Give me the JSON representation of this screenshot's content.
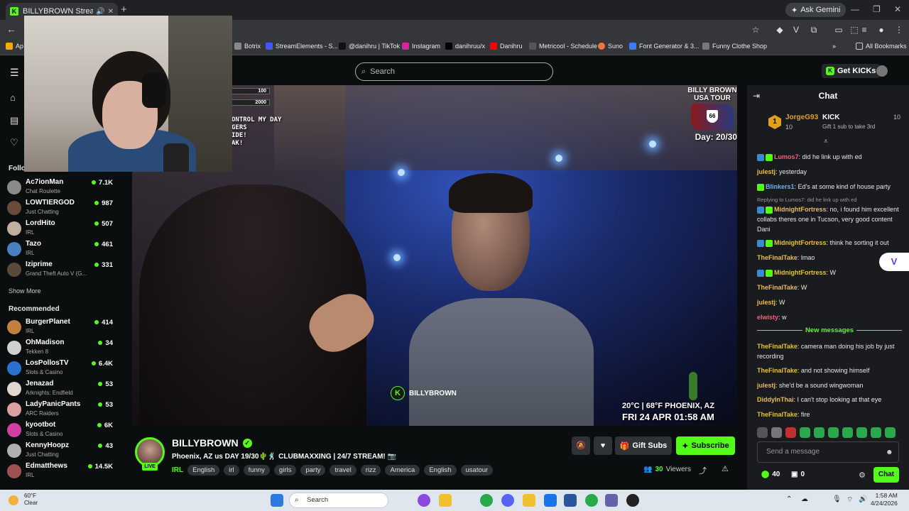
{
  "browser": {
    "tab_title": "BILLYBROWN Stream - Wa",
    "gemini_label": "Ask Gemini",
    "bookmarks": [
      "Ap",
      "Botrix",
      "StreamElements - S...",
      "@danihru | TikTok",
      "Instagram",
      "danihruu/x",
      "Danihru",
      "Metricool - Schedule",
      "Suno",
      "Font Generator & 3...",
      "Funny Clothe Shop"
    ],
    "all_bookmarks": "All Bookmarks"
  },
  "header": {
    "search_placeholder": "Search",
    "get_kicks": "Get KICKs"
  },
  "sidebar": {
    "following_title": "Follo",
    "following": [
      {
        "name": "Ac7ionMan",
        "category": "Chat Roulette",
        "viewers": "7.1K"
      },
      {
        "name": "LOWTIERGOD",
        "category": "Just Chatting",
        "viewers": "987"
      },
      {
        "name": "LordHito",
        "category": "IRL",
        "viewers": "507"
      },
      {
        "name": "Tazo",
        "category": "IRL",
        "viewers": "461"
      },
      {
        "name": "Iziprime",
        "category": "Grand Theft Auto V (G...",
        "viewers": "331"
      }
    ],
    "show_more": "Show More",
    "recommended_title": "Recommended",
    "recommended": [
      {
        "name": "BurgerPlanet",
        "category": "IRL",
        "viewers": "414"
      },
      {
        "name": "OhMadison",
        "category": "Tekken 8",
        "viewers": "34"
      },
      {
        "name": "LosPollosTV",
        "category": "Slots & Casino",
        "viewers": "6.4K"
      },
      {
        "name": "Jenazad",
        "category": "Arknights: Endfield",
        "viewers": "53"
      },
      {
        "name": "LadyPanicPants",
        "category": "ARC Raiders",
        "viewers": "53"
      },
      {
        "name": "kyootbot",
        "category": "Slots & Casino",
        "viewers": "6K"
      },
      {
        "name": "KennyHoopz",
        "category": "Just Chatting",
        "viewers": "43"
      },
      {
        "name": "Edmatthews",
        "category": "IRL",
        "viewers": "14.5K"
      }
    ]
  },
  "video": {
    "goal1": "100",
    "goal2": "2000",
    "overlay_lines": [
      "ONTROL MY DAY",
      "GERS",
      "IDE!",
      "AK!"
    ],
    "tour_title": "BILLY BROWN USA TOUR",
    "tour_route": "66",
    "tour_day": "Day: 20/30",
    "watermark": "BILLYBROWN",
    "weather": "20°C | 68°F PHOENIX, AZ",
    "date": "FRI 24 APR 01:58 AM"
  },
  "stream": {
    "channel": "BILLYBROWN",
    "live": "LIVE",
    "title": "Phoenix, AZ us DAY 19/30🌵🕺 CLUBMAXXING | 24/7 STREAM! 📷",
    "category": "IRL",
    "tags": [
      "English",
      "irl",
      "funny",
      "girls",
      "party",
      "travel",
      "rizz",
      "America",
      "English",
      "usatour"
    ],
    "gift_subs": "Gift Subs",
    "subscribe": "Subscribe",
    "viewers": "30",
    "viewers_label": "Viewers"
  },
  "chat": {
    "title": "Chat",
    "pinned": {
      "rank": "1",
      "user": "JorgeG93",
      "count": "10",
      "kick": "KICK",
      "kick_count": "10",
      "gift_text": "Gift 1 sub to take 3rd"
    },
    "messages": [
      {
        "user": "Lumos7",
        "text": "did he link up with ed",
        "color": "#ff5a7a"
      },
      {
        "user": "julestj",
        "text": "yesterday",
        "color": "#e8c040"
      },
      {
        "user": "Blinkers1",
        "text": "Ed's at some kind of house party",
        "color": "#6ab0ff"
      },
      {
        "user": "MidnightFortress",
        "text": "no, i found him excellent collabs theres one in Tucson, very good content Dani",
        "color": "#e8c040"
      },
      {
        "user": "MidnightFortress",
        "text": "think he sorting it out",
        "color": "#e8c040"
      },
      {
        "user": "TheFinalTake",
        "text": "lmao",
        "color": "#e8c040"
      },
      {
        "user": "MidnightFortress",
        "text": "W",
        "color": "#e8c040"
      },
      {
        "user": "TheFinalTake",
        "text": "W",
        "color": "#e8c040"
      },
      {
        "user": "julestj",
        "text": "W",
        "color": "#e8c040"
      },
      {
        "user": "elwisty",
        "text": "w",
        "color": "#ff5a7a"
      },
      {
        "user": "TheFinalTake",
        "text": "camera man doing his job by just recording",
        "color": "#e8c040"
      },
      {
        "user": "TheFinalTake",
        "text": "and not showing himself",
        "color": "#e8c040"
      },
      {
        "user": "julestj",
        "text": "she'd be a sound wingwoman",
        "color": "#e8c040"
      },
      {
        "user": "DiddyInThai",
        "text": "I can't stop looking at that eye",
        "color": "#e8c040"
      },
      {
        "user": "TheFinalTake",
        "text": "fire",
        "color": "#e8c040"
      }
    ],
    "reply_text": "Replying to Lumos7: did he link up with ed",
    "new_messages": "New messages",
    "input_placeholder": "Send a message",
    "points": "40",
    "points2": "0",
    "send": "Chat"
  },
  "taskbar": {
    "temp": "60°F",
    "condition": "Clear",
    "search": "Search",
    "time": "1:58 AM",
    "date": "4/24/2026"
  }
}
